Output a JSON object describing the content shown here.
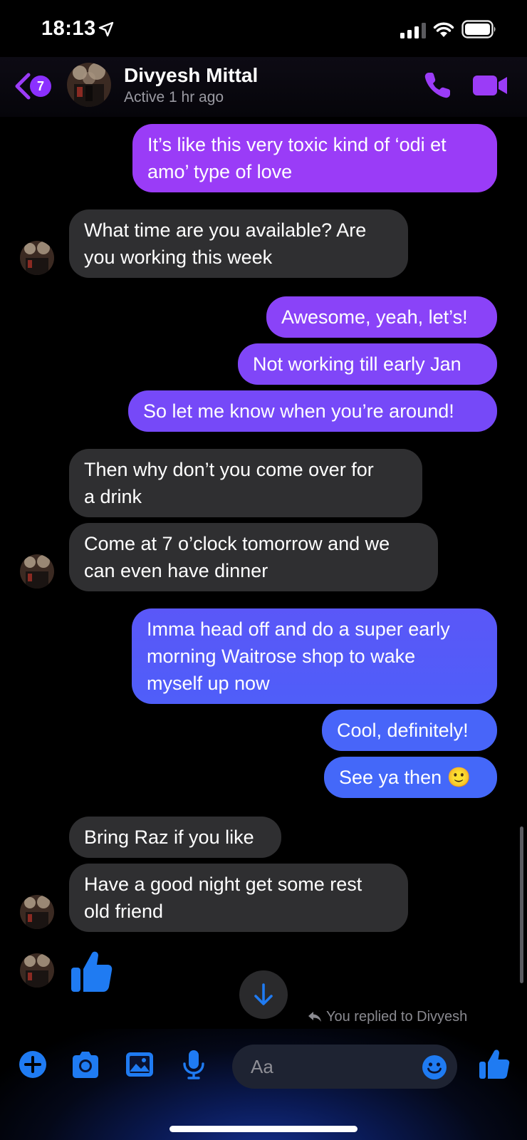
{
  "status_bar": {
    "time": "18:13"
  },
  "header": {
    "unread_count": "7",
    "contact_name": "Divyesh Mittal",
    "contact_status": "Active 1 hr ago"
  },
  "messages": [
    {
      "from": "me",
      "text_lines": [
        "It’s like this very toxic kind of ‘odi et",
        "amo’ type of love"
      ]
    },
    {
      "from": "them",
      "text_lines": [
        "What time are you available? Are",
        "you working this week"
      ]
    },
    {
      "from": "me",
      "text_lines": [
        "Awesome, yeah, let’s!"
      ]
    },
    {
      "from": "me",
      "text_lines": [
        "Not working till early Jan"
      ]
    },
    {
      "from": "me",
      "text_lines": [
        "So let me know when you’re around!"
      ]
    },
    {
      "from": "them",
      "text_lines": [
        "Then why don’t you come over for",
        "a drink"
      ]
    },
    {
      "from": "them",
      "text_lines": [
        "Come at 7 o’clock tomorrow and we",
        "can even have dinner"
      ]
    },
    {
      "from": "me",
      "text_lines": [
        "Imma head off and do a super early",
        "morning Waitrose shop to wake",
        "myself up now"
      ]
    },
    {
      "from": "me",
      "text_lines": [
        "Cool, definitely!"
      ]
    },
    {
      "from": "me",
      "text_lines": [
        "See ya then 🙂"
      ]
    },
    {
      "from": "them",
      "text_lines": [
        "Bring Raz if you like"
      ]
    },
    {
      "from": "them",
      "text_lines": [
        "Have a good night get some rest",
        "old friend"
      ]
    },
    {
      "from": "them",
      "type": "thumbs-up-icon"
    }
  ],
  "reply_note": "You replied to Divyesh",
  "composer": {
    "placeholder": "Aa"
  },
  "colors": {
    "accent_purple": "#9b3cf7",
    "sent_gradient_top": "#9b3cf7",
    "sent_gradient_bottom": "#3f6cf9",
    "received_bubble": "#2f2f31",
    "thumbs_blue": "#1f7bf2"
  }
}
